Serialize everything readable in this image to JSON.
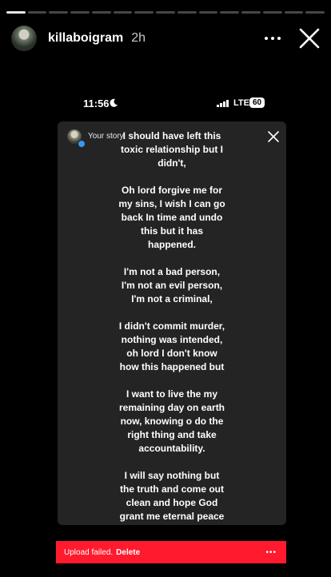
{
  "progress": {
    "segments": 15,
    "completed": 1
  },
  "header": {
    "username": "killaboigram",
    "time_ago": "2h"
  },
  "status_bar": {
    "time": "11:56",
    "network": "LTE",
    "battery": "60"
  },
  "card": {
    "your_story_label": "Your story",
    "paragraphs": [
      "I should have left this\ntoxic relationship but  I\ndidn't,",
      "Oh lord forgive me for\nmy sins, I wish I can go\nback In time and undo\nthis but it has\nhappened.",
      "I'm not a bad person,\nI'm not an evil person,\nI'm not a criminal,",
      "I didn't commit murder,\nnothing was intended,\noh lord I don't know\nhow this happened but",
      "I want to live the my\nremaining day on earth\nnow, knowing o do the\nright thing and take\naccountability.",
      "I will say nothing but\nthe truth and come out\nclean and hope God\ngrant me eternal peace\nand accept me."
    ]
  },
  "upload_bar": {
    "message": "Upload failed.",
    "delete_label": "Delete",
    "more_label": "•••"
  },
  "colors": {
    "background": "#000000",
    "card": "#242424",
    "upload_bar": "#ff1a2e"
  }
}
